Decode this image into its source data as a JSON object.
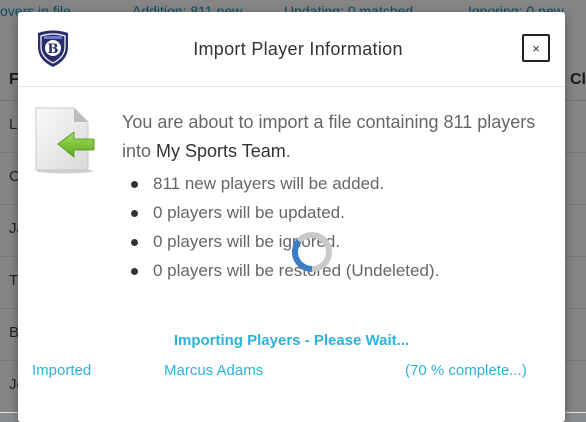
{
  "background": {
    "topbar": [
      "overs in file",
      "Addition: 811 new",
      "Updating: 0 matched",
      "Ignoring: 0 new"
    ],
    "header_left": "F",
    "header_right": "Cl",
    "rows": [
      "L",
      "C",
      "Ja",
      "Th",
      "Br",
      "Je"
    ]
  },
  "modal": {
    "title": "Import Player Information",
    "close_label": "×",
    "message_prefix": "You are about to import a file containing 811 players into ",
    "team_name": "My Sports Team",
    "message_suffix": ".",
    "bullets": [
      "811 new players will be added.",
      "0 players will be updated.",
      "0 players will be ignored.",
      "0 players will be restored (Undeleted)."
    ],
    "status": "Importing Players - Please Wait...",
    "progress": {
      "label": "Imported",
      "current_player": "Marcus Adams",
      "percent_text": "(70 % complete...)",
      "percent": 70
    }
  },
  "colors": {
    "accent": "#2bb3d8",
    "link": "#1a8fbf",
    "arrow": "#7cc63a",
    "shield": "#2a2d6b"
  },
  "icons": {
    "logo": "team-shield-logo",
    "file": "file-import-icon",
    "spinner": "loading-spinner"
  }
}
